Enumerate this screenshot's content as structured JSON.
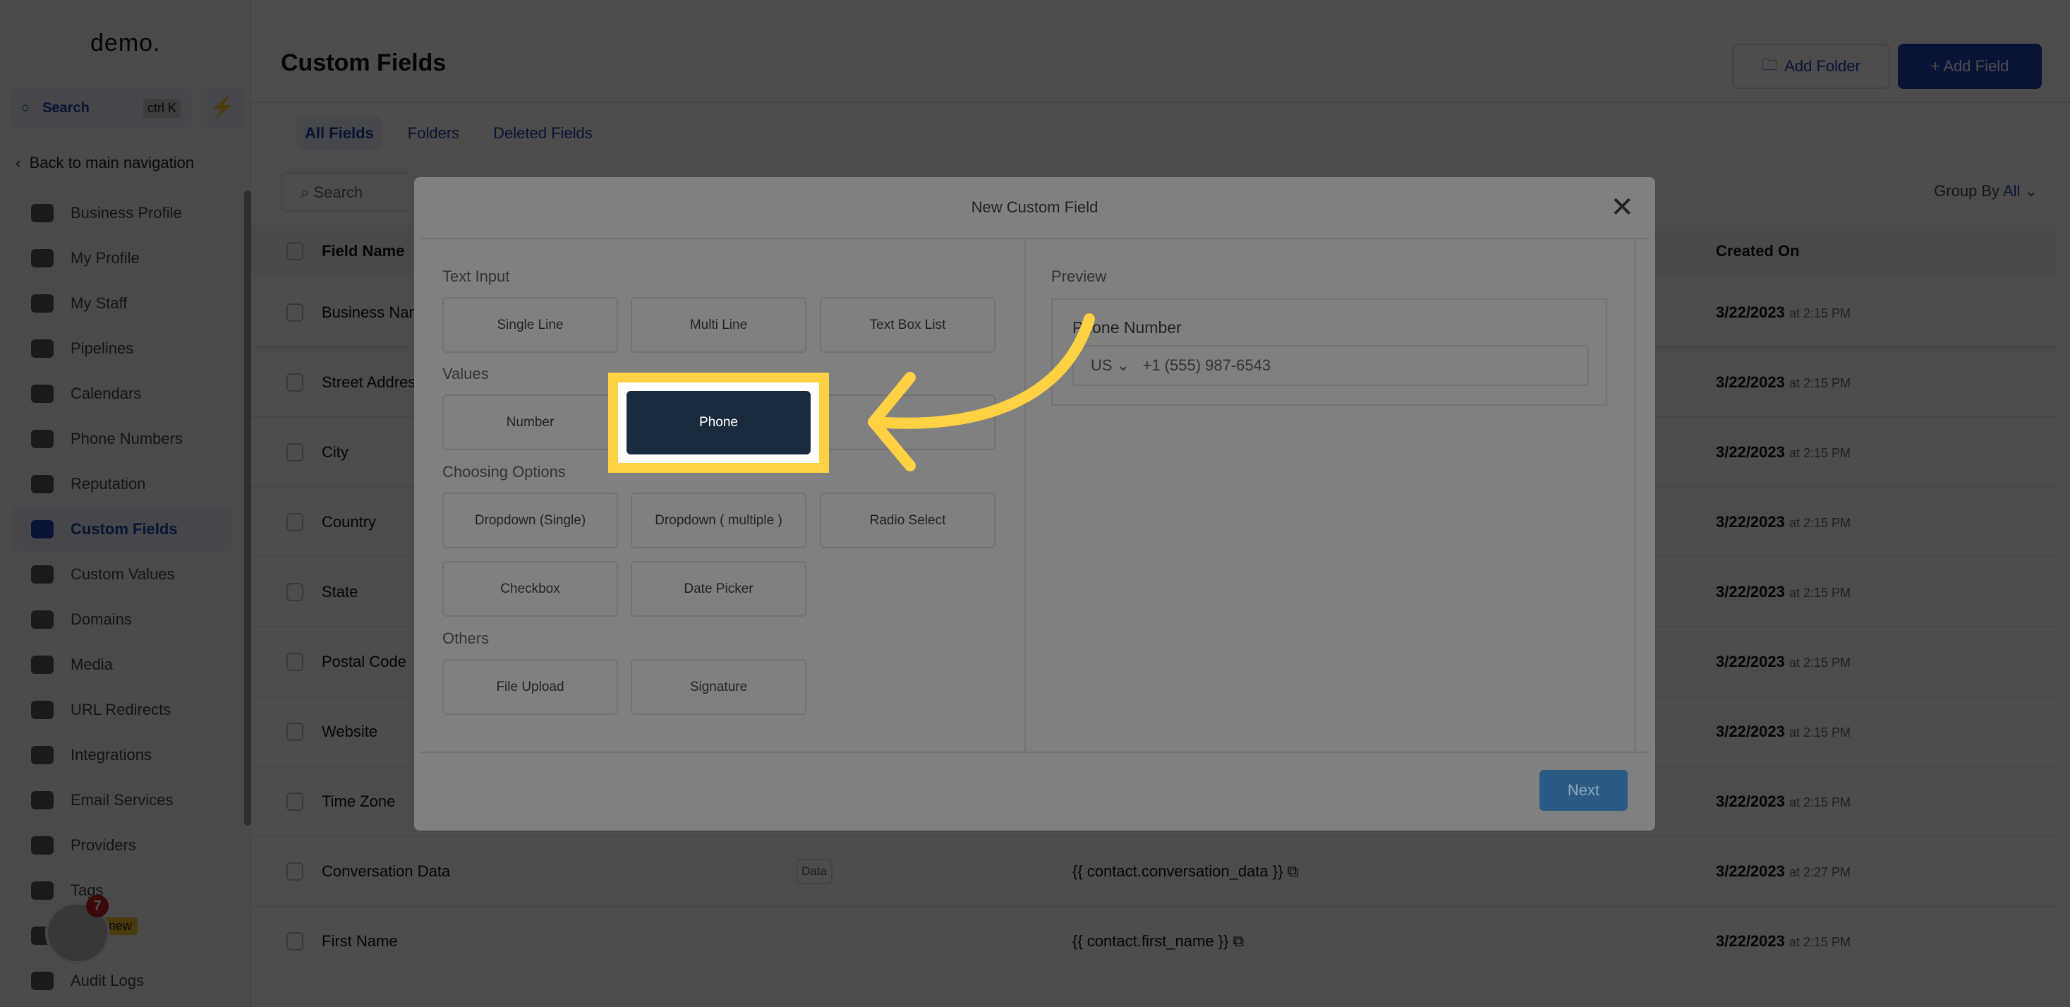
{
  "sidebar": {
    "logo": "demo.",
    "search_label": "Search",
    "search_shortcut": "ctrl K",
    "back_label": "Back to main navigation",
    "items": [
      {
        "label": "Business Profile"
      },
      {
        "label": "My Profile"
      },
      {
        "label": "My Staff"
      },
      {
        "label": "Pipelines"
      },
      {
        "label": "Calendars"
      },
      {
        "label": "Phone Numbers"
      },
      {
        "label": "Reputation"
      },
      {
        "label": "Custom Fields",
        "active": true
      },
      {
        "label": "Custom Values"
      },
      {
        "label": "Domains"
      },
      {
        "label": "Media"
      },
      {
        "label": "URL Redirects"
      },
      {
        "label": "Integrations"
      },
      {
        "label": "Email Services"
      },
      {
        "label": "Providers"
      },
      {
        "label": "Tags"
      },
      {
        "label": ""
      },
      {
        "label": "Audit Logs"
      }
    ],
    "new_badge": "new",
    "chat_badge": "7"
  },
  "header": {
    "title": "Custom Fields",
    "add_folder": "Add Folder",
    "add_field": "+ Add Field"
  },
  "tabs": [
    {
      "label": "All Fields",
      "active": true
    },
    {
      "label": "Folders"
    },
    {
      "label": "Deleted Fields"
    }
  ],
  "search": {
    "placeholder": "Search"
  },
  "group_by": {
    "label": "Group By",
    "value": "All"
  },
  "table": {
    "columns": {
      "name": "Field Name",
      "created": "Created On"
    },
    "rows": [
      {
        "name": "Business Name",
        "tag": "",
        "key": "",
        "date": "3/22/2023",
        "time": "at 2:15 PM"
      },
      {
        "name": "Street Address",
        "tag": "",
        "key": "",
        "date": "3/22/2023",
        "time": "at 2:15 PM"
      },
      {
        "name": "City",
        "tag": "",
        "key": "",
        "date": "3/22/2023",
        "time": "at 2:15 PM"
      },
      {
        "name": "Country",
        "tag": "",
        "key": "",
        "date": "3/22/2023",
        "time": "at 2:15 PM"
      },
      {
        "name": "State",
        "tag": "",
        "key": "",
        "date": "3/22/2023",
        "time": "at 2:15 PM"
      },
      {
        "name": "Postal Code",
        "tag": "",
        "key": "",
        "date": "3/22/2023",
        "time": "at 2:15 PM"
      },
      {
        "name": "Website",
        "tag": "",
        "key": "",
        "date": "3/22/2023",
        "time": "at 2:15 PM"
      },
      {
        "name": "Time Zone",
        "tag": "",
        "key": "",
        "date": "3/22/2023",
        "time": "at 2:15 PM"
      },
      {
        "name": "Conversation Data",
        "tag": "Data",
        "key": "{{ contact.conversation_data }}",
        "date": "3/22/2023",
        "time": "at 2:27 PM"
      },
      {
        "name": "First Name",
        "tag": "",
        "key": "{{ contact.first_name }}",
        "date": "3/22/2023",
        "time": "at 2:15 PM"
      }
    ]
  },
  "modal": {
    "title": "New Custom Field",
    "sections": {
      "text_input": "Text Input",
      "values": "Values",
      "choosing": "Choosing Options",
      "others": "Others"
    },
    "options": {
      "single_line": "Single Line",
      "multi_line": "Multi Line",
      "text_box_list": "Text Box List",
      "number": "Number",
      "phone": "Phone",
      "dropdown_single": "Dropdown (Single)",
      "dropdown_multiple": "Dropdown ( multiple )",
      "radio": "Radio Select",
      "checkbox": "Checkbox",
      "date_picker": "Date Picker",
      "file_upload": "File Upload",
      "signature": "Signature"
    },
    "preview": {
      "label": "Preview",
      "field_name": "Phone Number",
      "country": "US",
      "placeholder": "+1 (555) 987-6543"
    },
    "next": "Next"
  },
  "colors": {
    "accent": "#1e40af",
    "highlight": "#ffd143",
    "selected_option": "#1a2b3d"
  }
}
